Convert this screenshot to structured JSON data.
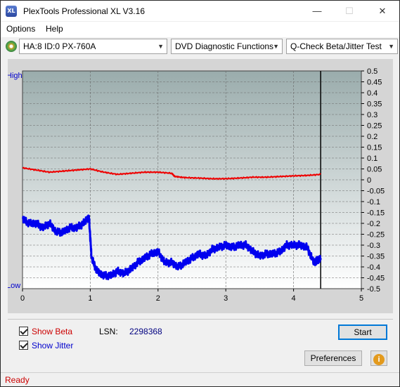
{
  "window": {
    "title": "PlexTools Professional XL V3.16",
    "app_icon_text": "XL",
    "minimize_glyph": "—",
    "maximize_glyph": "☐",
    "close_glyph": "✕"
  },
  "menu": {
    "items": [
      "Options",
      "Help"
    ]
  },
  "toolbar": {
    "drive": "HA:8 ID:0  PX-760A",
    "function": "DVD Diagnostic Functions",
    "test": "Q-Check Beta/Jitter Test"
  },
  "chart_labels": {
    "high": "High",
    "low": "Low"
  },
  "controls": {
    "show_beta": "Show Beta",
    "show_jitter": "Show Jitter",
    "show_beta_checked": true,
    "show_jitter_checked": true,
    "lsn_label": "LSN:",
    "lsn_value": "2298368",
    "start": "Start",
    "preferences": "Preferences",
    "info_glyph": "i"
  },
  "status": {
    "text": "Ready"
  },
  "colors": {
    "beta": "#ee0000",
    "jitter": "#0000ee",
    "axis_text": "#000000"
  },
  "chart_data": {
    "type": "line",
    "xlim": [
      0,
      5
    ],
    "ylim": [
      -0.5,
      0.5
    ],
    "x_ticks": [
      "0",
      "1",
      "2",
      "3",
      "4",
      "5"
    ],
    "y_ticks": [
      "0.5",
      "0.45",
      "0.4",
      "0.35",
      "0.3",
      "0.25",
      "0.2",
      "0.15",
      "0.1",
      "0.05",
      "0",
      "-0.05",
      "-0.1",
      "-0.15",
      "-0.2",
      "-0.25",
      "-0.3",
      "-0.35",
      "-0.4",
      "-0.45",
      "-0.5"
    ],
    "marker_x": 4.4,
    "series": [
      {
        "name": "Beta",
        "x": [
          0,
          0.2,
          0.4,
          0.6,
          0.8,
          1.0,
          1.2,
          1.4,
          1.6,
          1.8,
          2.0,
          2.2,
          2.25,
          2.4,
          2.6,
          2.8,
          3.0,
          3.2,
          3.4,
          3.6,
          3.8,
          4.0,
          4.2,
          4.4
        ],
        "y": [
          0.055,
          0.045,
          0.035,
          0.04,
          0.045,
          0.05,
          0.035,
          0.025,
          0.03,
          0.035,
          0.035,
          0.03,
          0.015,
          0.01,
          0.008,
          0.005,
          0.005,
          0.008,
          0.012,
          0.012,
          0.015,
          0.018,
          0.02,
          0.025
        ]
      },
      {
        "name": "Jitter",
        "x": [
          0,
          0.1,
          0.2,
          0.3,
          0.4,
          0.5,
          0.6,
          0.7,
          0.8,
          0.9,
          0.98,
          1.02,
          1.1,
          1.2,
          1.3,
          1.4,
          1.5,
          1.6,
          1.7,
          1.8,
          1.9,
          2.0,
          2.1,
          2.2,
          2.3,
          2.4,
          2.5,
          2.6,
          2.7,
          2.8,
          2.9,
          3.0,
          3.1,
          3.2,
          3.3,
          3.4,
          3.5,
          3.6,
          3.7,
          3.8,
          3.9,
          4.0,
          4.1,
          4.2,
          4.3,
          4.35,
          4.4
        ],
        "y": [
          -0.18,
          -0.2,
          -0.2,
          -0.22,
          -0.2,
          -0.24,
          -0.24,
          -0.22,
          -0.22,
          -0.2,
          -0.17,
          -0.36,
          -0.42,
          -0.44,
          -0.44,
          -0.42,
          -0.43,
          -0.41,
          -0.38,
          -0.36,
          -0.34,
          -0.33,
          -0.38,
          -0.38,
          -0.4,
          -0.38,
          -0.36,
          -0.34,
          -0.35,
          -0.32,
          -0.31,
          -0.3,
          -0.31,
          -0.3,
          -0.3,
          -0.33,
          -0.35,
          -0.34,
          -0.34,
          -0.33,
          -0.3,
          -0.3,
          -0.3,
          -0.31,
          -0.38,
          -0.37,
          -0.36
        ]
      }
    ]
  }
}
